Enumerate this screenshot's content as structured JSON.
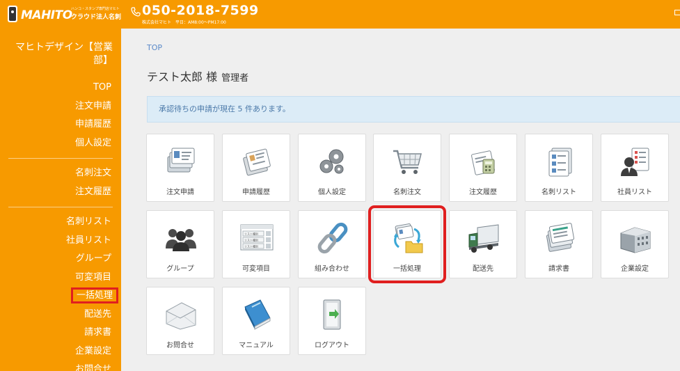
{
  "header": {
    "brand": "MAHITO",
    "tagline": "ハンコ・スタンプ専門店マヒト",
    "service": "クラウド法人名刺",
    "phone": "050-2018-7599",
    "hours": "株式会社マヒト　平日：AM8:00〜PM17:00"
  },
  "sidebar": {
    "company": "マヒトデザイン【営業部】",
    "group1": [
      "TOP",
      "注文申請",
      "申請履歴",
      "個人設定"
    ],
    "group2": [
      "名刺注文",
      "注文履歴"
    ],
    "group3": [
      "名刺リスト",
      "社員リスト",
      "グループ",
      "可変項目",
      "一括処理",
      "配送先",
      "請求書",
      "企業設定",
      "お問合せ"
    ],
    "active": "一括処理"
  },
  "main": {
    "breadcrumb": "TOP",
    "user_name": "テスト太郎 様",
    "user_role": "管理者",
    "notice": "承認待ちの申請が現在 5 件あります。",
    "tiles": [
      {
        "label": "注文申請",
        "icon": "order-request-icon"
      },
      {
        "label": "申請履歴",
        "icon": "request-history-icon"
      },
      {
        "label": "個人設定",
        "icon": "gears-icon"
      },
      {
        "label": "名刺注文",
        "icon": "cart-icon"
      },
      {
        "label": "注文履歴",
        "icon": "order-history-icon"
      },
      {
        "label": "名刺リスト",
        "icon": "card-list-icon"
      },
      {
        "label": "社員リスト",
        "icon": "employee-list-icon"
      },
      {
        "label": "グループ",
        "icon": "group-icon"
      },
      {
        "label": "可変項目",
        "icon": "variable-items-icon"
      },
      {
        "label": "組み合わせ",
        "icon": "chain-link-icon"
      },
      {
        "label": "一括処理",
        "icon": "batch-process-icon"
      },
      {
        "label": "配送先",
        "icon": "truck-icon"
      },
      {
        "label": "請求書",
        "icon": "invoice-icon"
      },
      {
        "label": "企業設定",
        "icon": "building-icon"
      },
      {
        "label": "お問合せ",
        "icon": "envelope-icon"
      },
      {
        "label": "マニュアル",
        "icon": "manual-book-icon"
      },
      {
        "label": "ログアウト",
        "icon": "logout-door-icon"
      }
    ],
    "variable_list_texts": [
      "リスト種別",
      "リスト種別",
      "リスト種別"
    ]
  },
  "colors": {
    "orange": "#f79a00",
    "highlight_red": "#e01f1f",
    "notice_bg": "#dcecf7",
    "link_blue": "#5b8ac9"
  }
}
